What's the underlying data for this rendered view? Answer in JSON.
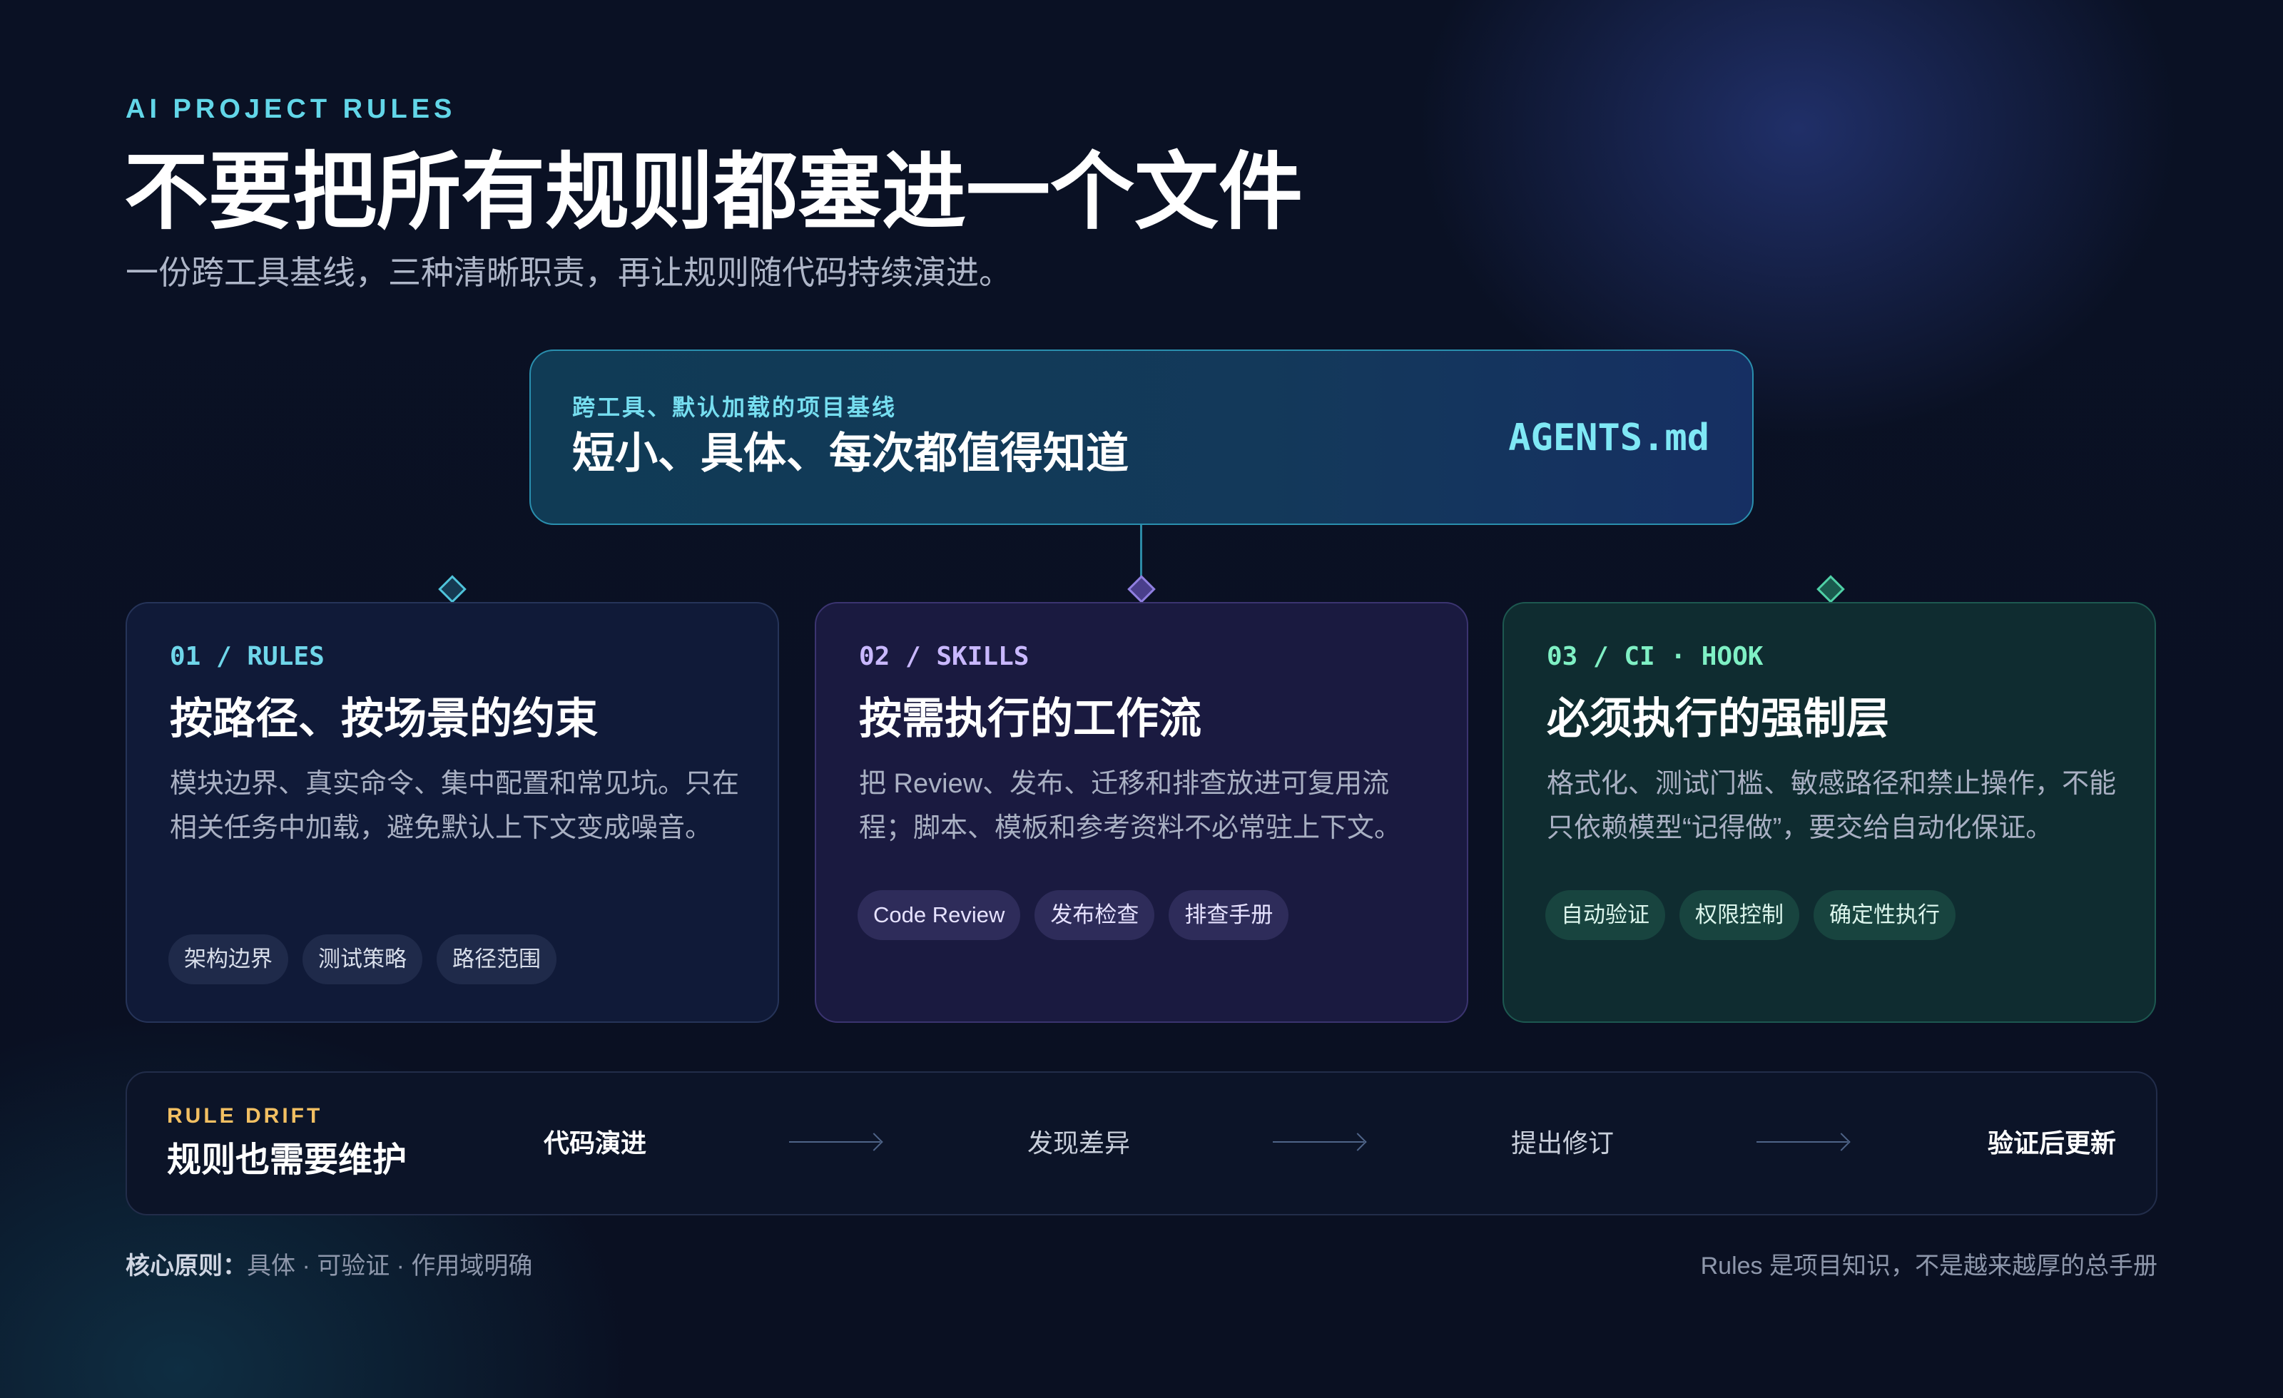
{
  "header": {
    "eyebrow": "AI PROJECT RULES",
    "title": "不要把所有规则都塞进一个文件",
    "subtitle": "一份跨工具基线，三种清晰职责，再让规则随代码持续演进。"
  },
  "agents": {
    "subtitle": "跨工具、默认加载的项目基线",
    "title": "短小、具体、每次都值得知道",
    "filename": "AGENTS.md"
  },
  "cards": [
    {
      "label": "01 / RULES",
      "title": "按路径、按场景的约束",
      "description": "模块边界、真实命令、集中配置和常见坑。只在相关任务中加载，避免默认上下文变成噪音。",
      "tags": [
        "架构边界",
        "测试策略",
        "路径范围"
      ]
    },
    {
      "label": "02 / SKILLS",
      "title": "按需执行的工作流",
      "description": "把 Review、发布、迁移和排查放进可复用流程；脚本、模板和参考资料不必常驻上下文。",
      "tags": [
        "Code Review",
        "发布检查",
        "排查手册"
      ]
    },
    {
      "label": "03 / CI · HOOK",
      "title": "必须执行的强制层",
      "description": "格式化、测试门槛、敏感路径和禁止操作，不能只依赖模型“记得做”，要交给自动化保证。",
      "tags": [
        "自动验证",
        "权限控制",
        "确定性执行"
      ]
    }
  ],
  "drift": {
    "label": "RULE DRIFT",
    "title": "规则也需要维护",
    "steps": [
      "代码演进",
      "发现差异",
      "提出修订",
      "验证后更新"
    ]
  },
  "footer": {
    "principle_label": "核心原则：",
    "principle_value": "具体 · 可验证 · 作用域明确",
    "note": "Rules 是项目知识，不是越来越厚的总手册"
  },
  "colors": {
    "accent_cyan": "#62d6e8",
    "rules_accent": "#6fd6ea",
    "skills_accent": "#c9b8ff",
    "ci_accent": "#7ff0c4",
    "drift_accent": "#f2bf62"
  }
}
